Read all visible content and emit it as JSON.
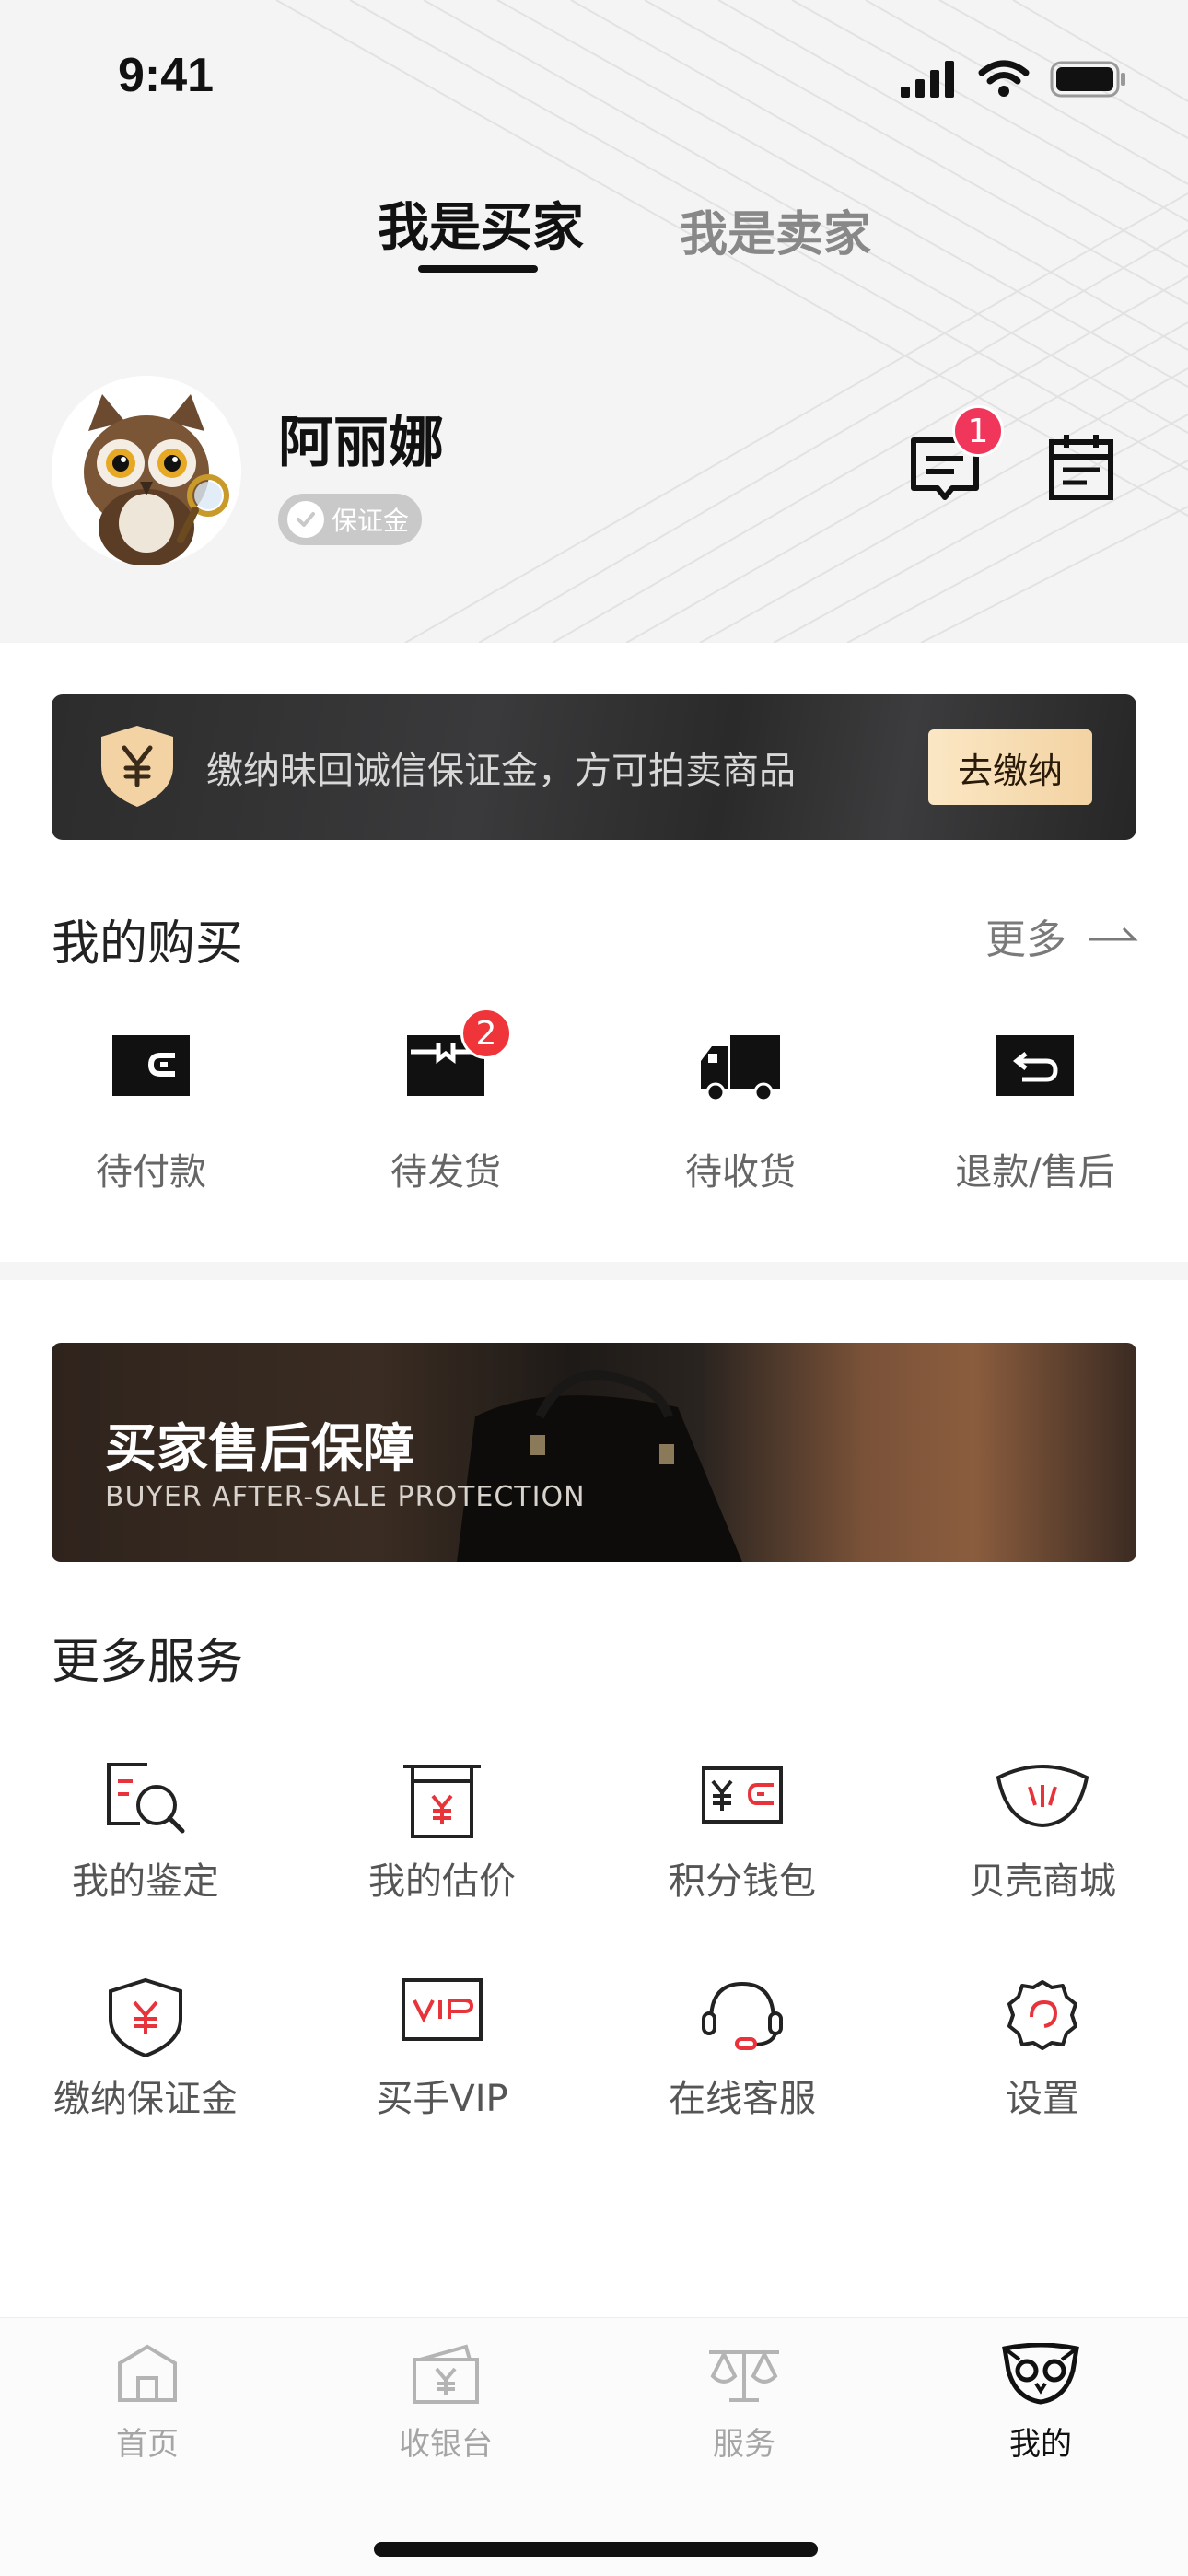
{
  "status_bar": {
    "time": "9:41"
  },
  "header": {
    "tabs": [
      {
        "label": "我是买家",
        "active": true
      },
      {
        "label": "我是卖家",
        "active": false
      }
    ],
    "user": {
      "name": "阿丽娜",
      "badge": "保证金"
    },
    "message_count": "1"
  },
  "deposit_banner": {
    "text": "缴纳昧回诚信保证金，方可拍卖商品",
    "button": "去缴纳"
  },
  "purchases": {
    "title": "我的购买",
    "more": "更多",
    "items": [
      {
        "label": "待付款",
        "icon": "wallet-icon"
      },
      {
        "label": "待发货",
        "icon": "package-icon",
        "badge": "2"
      },
      {
        "label": "待收货",
        "icon": "truck-icon"
      },
      {
        "label": "退款/售后",
        "icon": "return-icon"
      }
    ]
  },
  "protection_banner": {
    "title": "买家售后保障",
    "subtitle": "BUYER AFTER-SALE PROTECTION"
  },
  "services": {
    "title": "更多服务",
    "items": [
      {
        "label": "我的鉴定",
        "icon": "appraisal-icon"
      },
      {
        "label": "我的估价",
        "icon": "valuation-icon"
      },
      {
        "label": "积分钱包",
        "icon": "points-wallet-icon"
      },
      {
        "label": "贝壳商城",
        "icon": "shell-mall-icon"
      },
      {
        "label": "缴纳保证金",
        "icon": "deposit-shield-icon"
      },
      {
        "label": "买手VIP",
        "icon": "vip-icon"
      },
      {
        "label": "在线客服",
        "icon": "headset-icon"
      },
      {
        "label": "设置",
        "icon": "settings-icon"
      }
    ]
  },
  "tabbar": {
    "items": [
      {
        "label": "首页",
        "icon": "home-icon",
        "active": false
      },
      {
        "label": "收银台",
        "icon": "cashier-icon",
        "active": false
      },
      {
        "label": "服务",
        "icon": "scale-icon",
        "active": false
      },
      {
        "label": "我的",
        "icon": "owl-icon",
        "active": true
      }
    ]
  },
  "colors": {
    "badge_red": "#f0353a",
    "message_badge": "#f0365a",
    "deposit_button": "#f6dcb2",
    "accent_red": "#e8333a"
  }
}
